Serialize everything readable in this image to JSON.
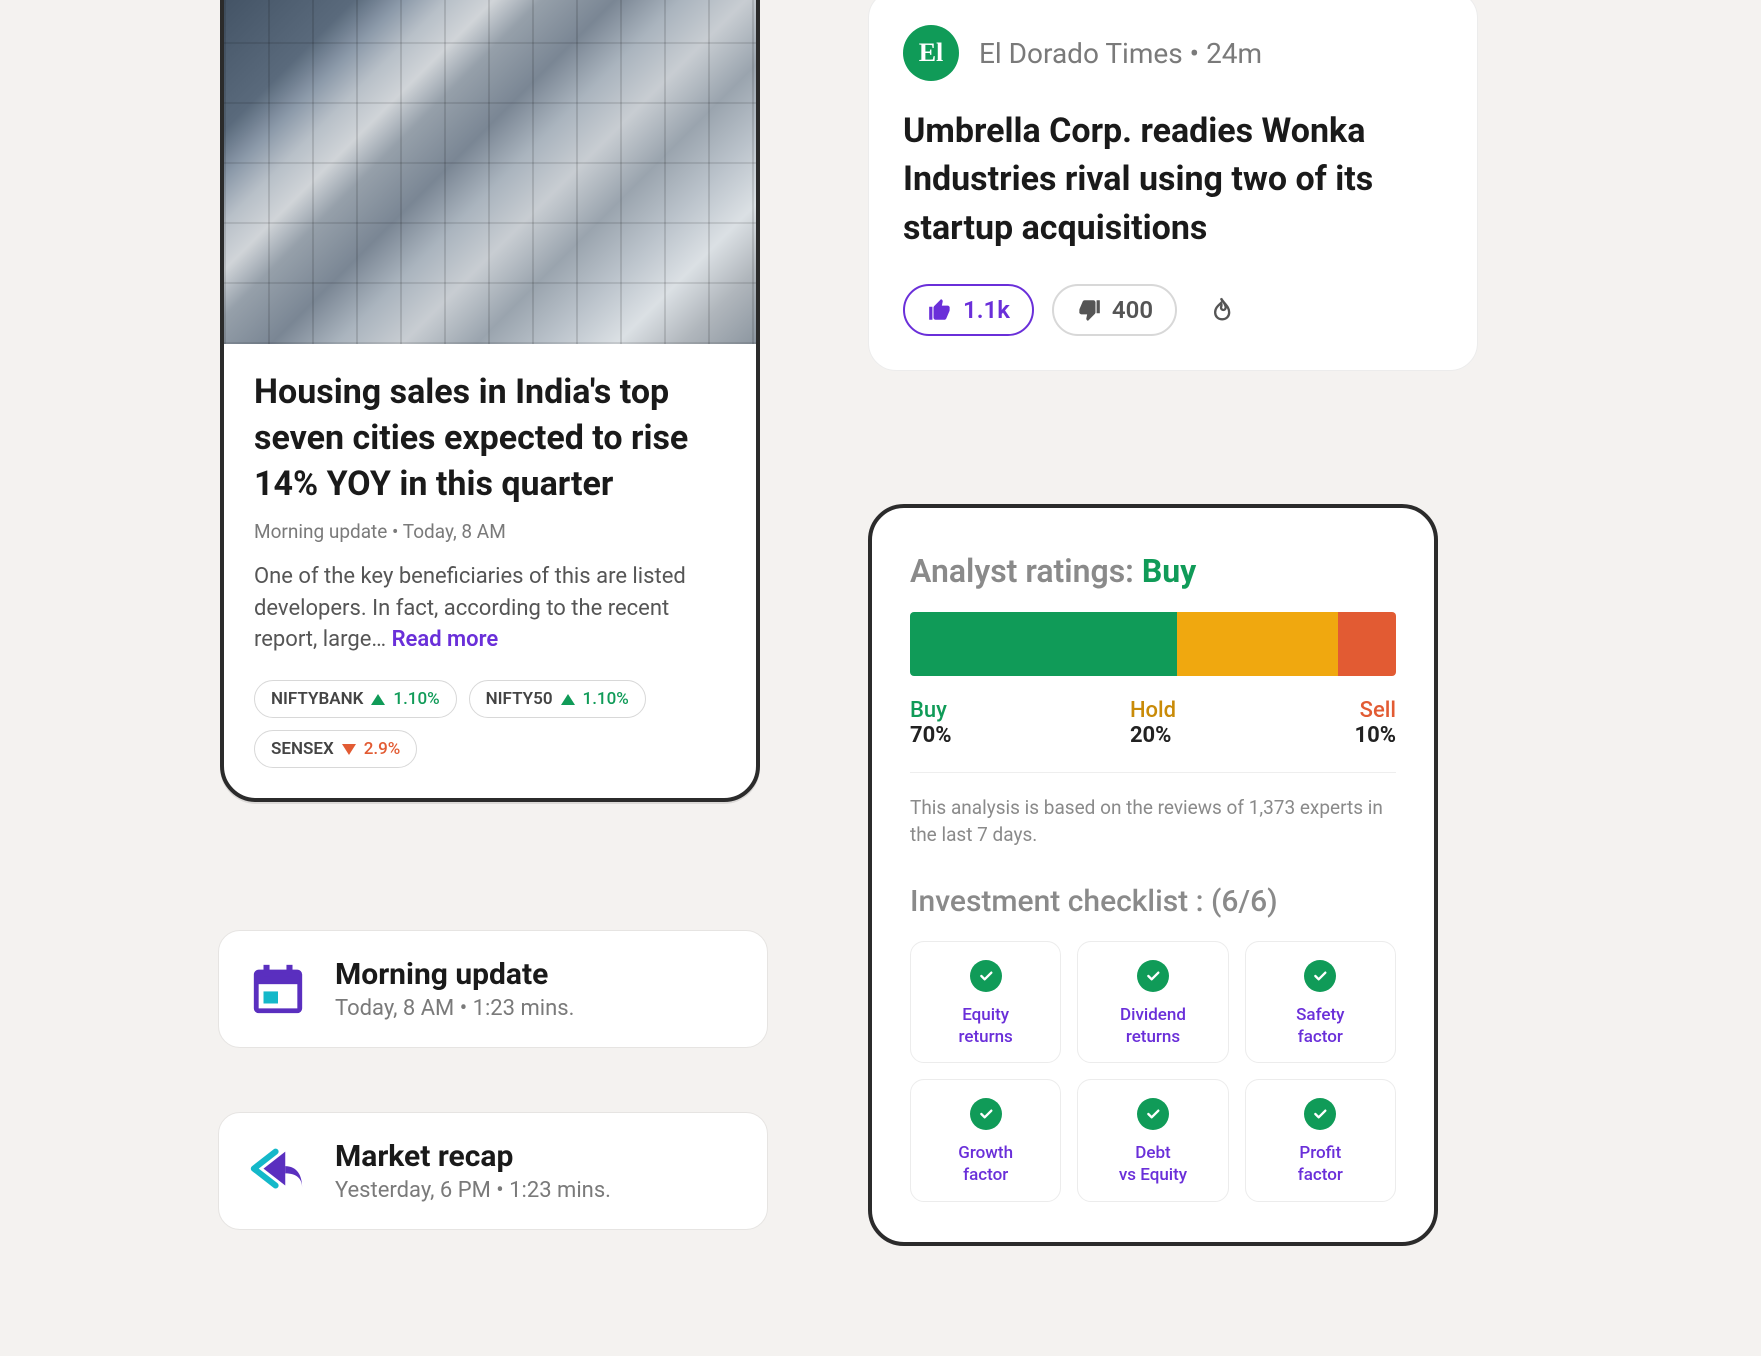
{
  "article": {
    "title": "Housing sales in India's top seven cities expected to rise 14% YOY in this quarter",
    "meta": "Morning update • Today, 8 AM",
    "excerpt": "One of the key beneficiaries of this are listed developers. In fact, according to the recent report, large… ",
    "read_more": "Read more",
    "tickers": [
      {
        "symbol": "NIFTYBANK",
        "dir": "up",
        "pct": "1.10%"
      },
      {
        "symbol": "NIFTY50",
        "dir": "up",
        "pct": "1.10%"
      },
      {
        "symbol": "SENSEX",
        "dir": "down",
        "pct": "2.9%"
      }
    ]
  },
  "updates": [
    {
      "title": "Morning update",
      "sub": "Today, 8 AM • 1:23 mins."
    },
    {
      "title": "Market recap",
      "sub": "Yesterday,  6 PM  • 1:23 mins."
    }
  ],
  "news": {
    "source_badge": "El",
    "source": "El Dorado Times",
    "time": "24m",
    "headline": "Umbrella Corp. readies Wonka Industries rival using two of its startup acquisitions",
    "likes": "1.1k",
    "dislikes": "400"
  },
  "analyst": {
    "title_prefix": "Analyst ratings: ",
    "title_value": "Buy",
    "note": "This analysis is based on the reviews of 1,373 experts in the last 7 days.",
    "checklist_title": "Investment checklist : (6/6)",
    "segments": {
      "buy": {
        "label": "Buy",
        "pct": "70%",
        "width": 55
      },
      "hold": {
        "label": "Hold",
        "pct": "20%",
        "width": 33
      },
      "sell": {
        "label": "Sell",
        "pct": "10%",
        "width": 12
      }
    },
    "checklist": [
      "Equity returns",
      "Dividend returns",
      "Safety factor",
      "Growth factor",
      "Debt vs Equity",
      "Profit factor"
    ]
  },
  "chart_data": {
    "type": "bar",
    "title": "Analyst ratings",
    "categories": [
      "Buy",
      "Hold",
      "Sell"
    ],
    "values": [
      70,
      20,
      10
    ],
    "colors": [
      "#109b58",
      "#f0a80f",
      "#e25b33"
    ],
    "ylim": [
      0,
      100
    ]
  }
}
